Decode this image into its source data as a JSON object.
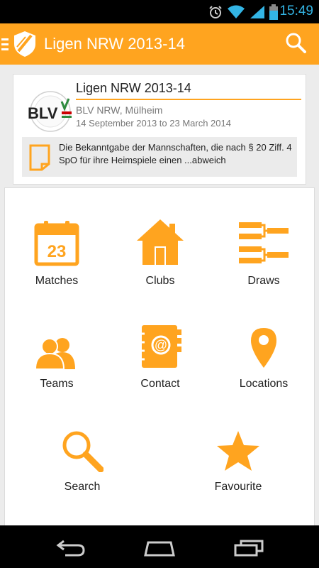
{
  "status_bar": {
    "time": "15:49"
  },
  "action_bar": {
    "title": "Ligen NRW 2013-14"
  },
  "header_card": {
    "title": "Ligen NRW 2013-14",
    "organizer": "BLV NRW, Mülheim",
    "dates": "14 September 2013 to 23 March 2014",
    "logo_text": "BLV",
    "notice": "Die Bekanntgabe der Mannschaften, die nach § 20 Ziff. 4 SpO für ihre Heimspiele einen ...abweich"
  },
  "menu": {
    "calendar_day": "23",
    "matches": "Matches",
    "clubs": "Clubs",
    "draws": "Draws",
    "teams": "Teams",
    "contact": "Contact",
    "locations": "Locations",
    "search": "Search",
    "favourite": "Favourite"
  },
  "colors": {
    "accent": "#ffa41f",
    "status_time": "#33b5e5"
  },
  "icons": [
    "menu-icon",
    "app-logo-icon",
    "search-icon",
    "calendar-icon",
    "house-icon",
    "bracket-icon",
    "people-icon",
    "address-book-icon",
    "map-pin-icon",
    "magnifier-icon",
    "star-icon",
    "back-icon",
    "home-icon",
    "recent-apps-icon"
  ]
}
